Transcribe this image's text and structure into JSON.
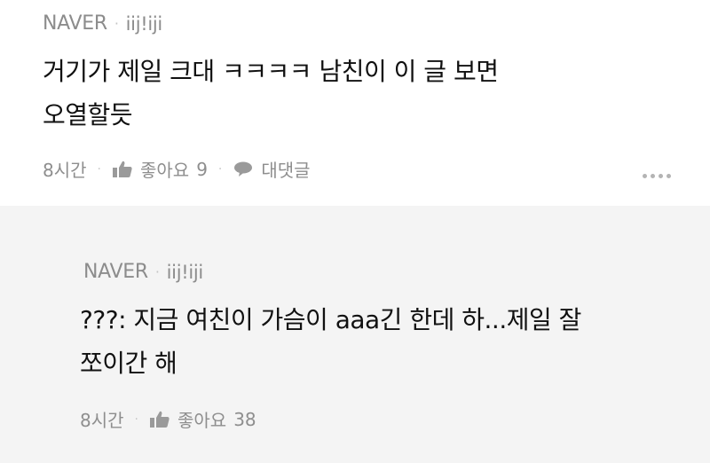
{
  "comments": [
    {
      "source": "NAVER",
      "user": "iij!iji",
      "text_lines": [
        "거기가 제일 크대 ㅋㅋㅋㅋ 남친이 이 글 보면",
        "오열할듯"
      ],
      "time": "8시간",
      "like_label": "좋아요",
      "like_count": "9",
      "reply_label": "대댓글"
    },
    {
      "source": "NAVER",
      "user": "iij!iji",
      "text_lines": [
        "???: 지금 여친이 가슴이 aaa긴 한데 하...제일 잘",
        "쪼이간 해"
      ],
      "time": "8시간",
      "like_label": "좋아요",
      "like_count": "38"
    }
  ],
  "colors": {
    "meta_text": "#8c8c8c",
    "body_text": "#111111",
    "reply_background": "#f4f4f4"
  },
  "icons": [
    "thumbs-up-icon",
    "speech-bubble-icon",
    "more-options-icon"
  ]
}
